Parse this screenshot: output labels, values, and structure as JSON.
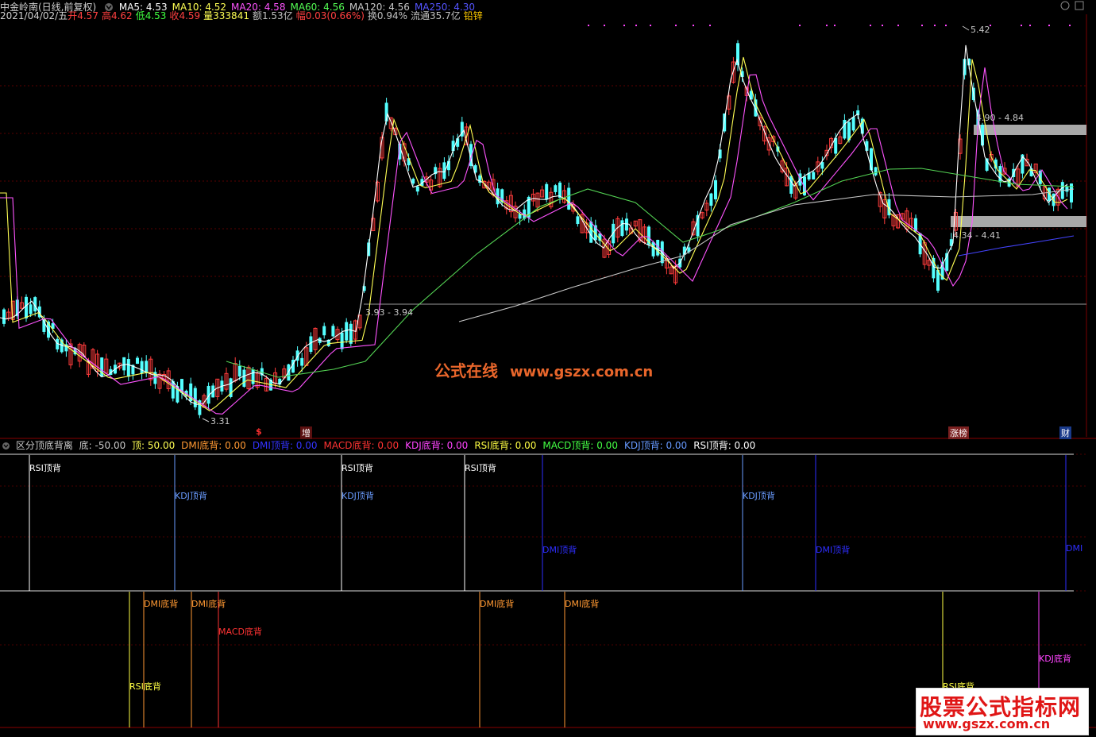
{
  "stock": {
    "name": "中金岭南(日线,前复权)",
    "date": "2021/04/02/五",
    "open_label": "开",
    "open": "4.57",
    "high_label": "高",
    "high": "4.62",
    "low_label": "低",
    "low": "4.53",
    "close_label": "收",
    "close": "4.59",
    "volume": "量333841",
    "amount": "额1.53亿",
    "change": "幅0.03(0.66%)",
    "turnover": "换0.94%",
    "float_value": "流通35.7亿",
    "industry": "铅锌"
  },
  "ma_legend": [
    {
      "label": "MA5: 4.53",
      "color": "#ffffff"
    },
    {
      "label": "MA10: 4.52",
      "color": "#ffff54"
    },
    {
      "label": "MA20: 4.58",
      "color": "#ff54ff"
    },
    {
      "label": "MA60: 4.56",
      "color": "#54ff54"
    },
    {
      "label": "MA120: 4.56",
      "color": "#c8c8c8"
    },
    {
      "label": "MA250: 4.30",
      "color": "#5454ff"
    }
  ],
  "price_labels": {
    "high_peak": "5.42",
    "low_trough": "3.31",
    "upper_zone": "4.90 - 4.84",
    "lower_zone": "4.34 - 4.41",
    "base_line": "3.93 - 3.94"
  },
  "event_markers": [
    {
      "label": "$",
      "color": "#ff3030"
    },
    {
      "label": "增",
      "color": "#ffffff"
    },
    {
      "label": "涨榜",
      "color": "#ffffff"
    },
    {
      "label": "财",
      "color": "#ffffff"
    }
  ],
  "watermark_center": {
    "cn": "公式在线",
    "url": "www.gszx.com.cn"
  },
  "watermark_logo": {
    "title": "股票公式指标网",
    "url": "www.gszx.com.cn"
  },
  "indicator": {
    "name": "区分顶底背离",
    "bottom": "底: -50.00",
    "top": "顶: 50.00",
    "items": [
      {
        "label": "DMI底背: 0.00",
        "color": "#ff9933"
      },
      {
        "label": "DMI顶背: 0.00",
        "color": "#3333ff"
      },
      {
        "label": "MACD底背: 0.00",
        "color": "#ff3333"
      },
      {
        "label": "KDJ底背: 0.00",
        "color": "#ff44ff"
      },
      {
        "label": "RSI底背: 0.00",
        "color": "#ffff44"
      },
      {
        "label": "MACD顶背: 0.00",
        "color": "#44ff44"
      },
      {
        "label": "KDJ顶背: 0.00",
        "color": "#6699ff"
      },
      {
        "label": "RSI顶背: 0.00",
        "color": "#ffffff"
      }
    ]
  },
  "signals_top": [
    {
      "label": "RSI顶背",
      "color": "#ffffff"
    },
    {
      "label": "KDJ顶背",
      "color": "#6a9cff"
    },
    {
      "label": "RSI顶背",
      "color": "#ffffff"
    },
    {
      "label": "KDJ顶背",
      "color": "#6a9cff"
    },
    {
      "label": "RSI顶背",
      "color": "#ffffff"
    },
    {
      "label": "DMI顶背",
      "color": "#2e2eff"
    },
    {
      "label": "KDJ顶背",
      "color": "#6a9cff"
    },
    {
      "label": "DMI顶背",
      "color": "#2e2eff"
    },
    {
      "label": "DMI",
      "color": "#2e2eff"
    }
  ],
  "signals_bottom": [
    {
      "label": "RSI底背",
      "color": "#ffff44"
    },
    {
      "label": "DMI底背",
      "color": "#ff9933"
    },
    {
      "label": "DMI底背",
      "color": "#ff9933"
    },
    {
      "label": "MACD底背",
      "color": "#ff3333"
    },
    {
      "label": "DMI底背",
      "color": "#ff9933"
    },
    {
      "label": "DMI底背",
      "color": "#ff9933"
    },
    {
      "label": "RSI底背",
      "color": "#ffff44"
    },
    {
      "label": "KDJ底背",
      "color": "#ff44ff"
    }
  ]
}
